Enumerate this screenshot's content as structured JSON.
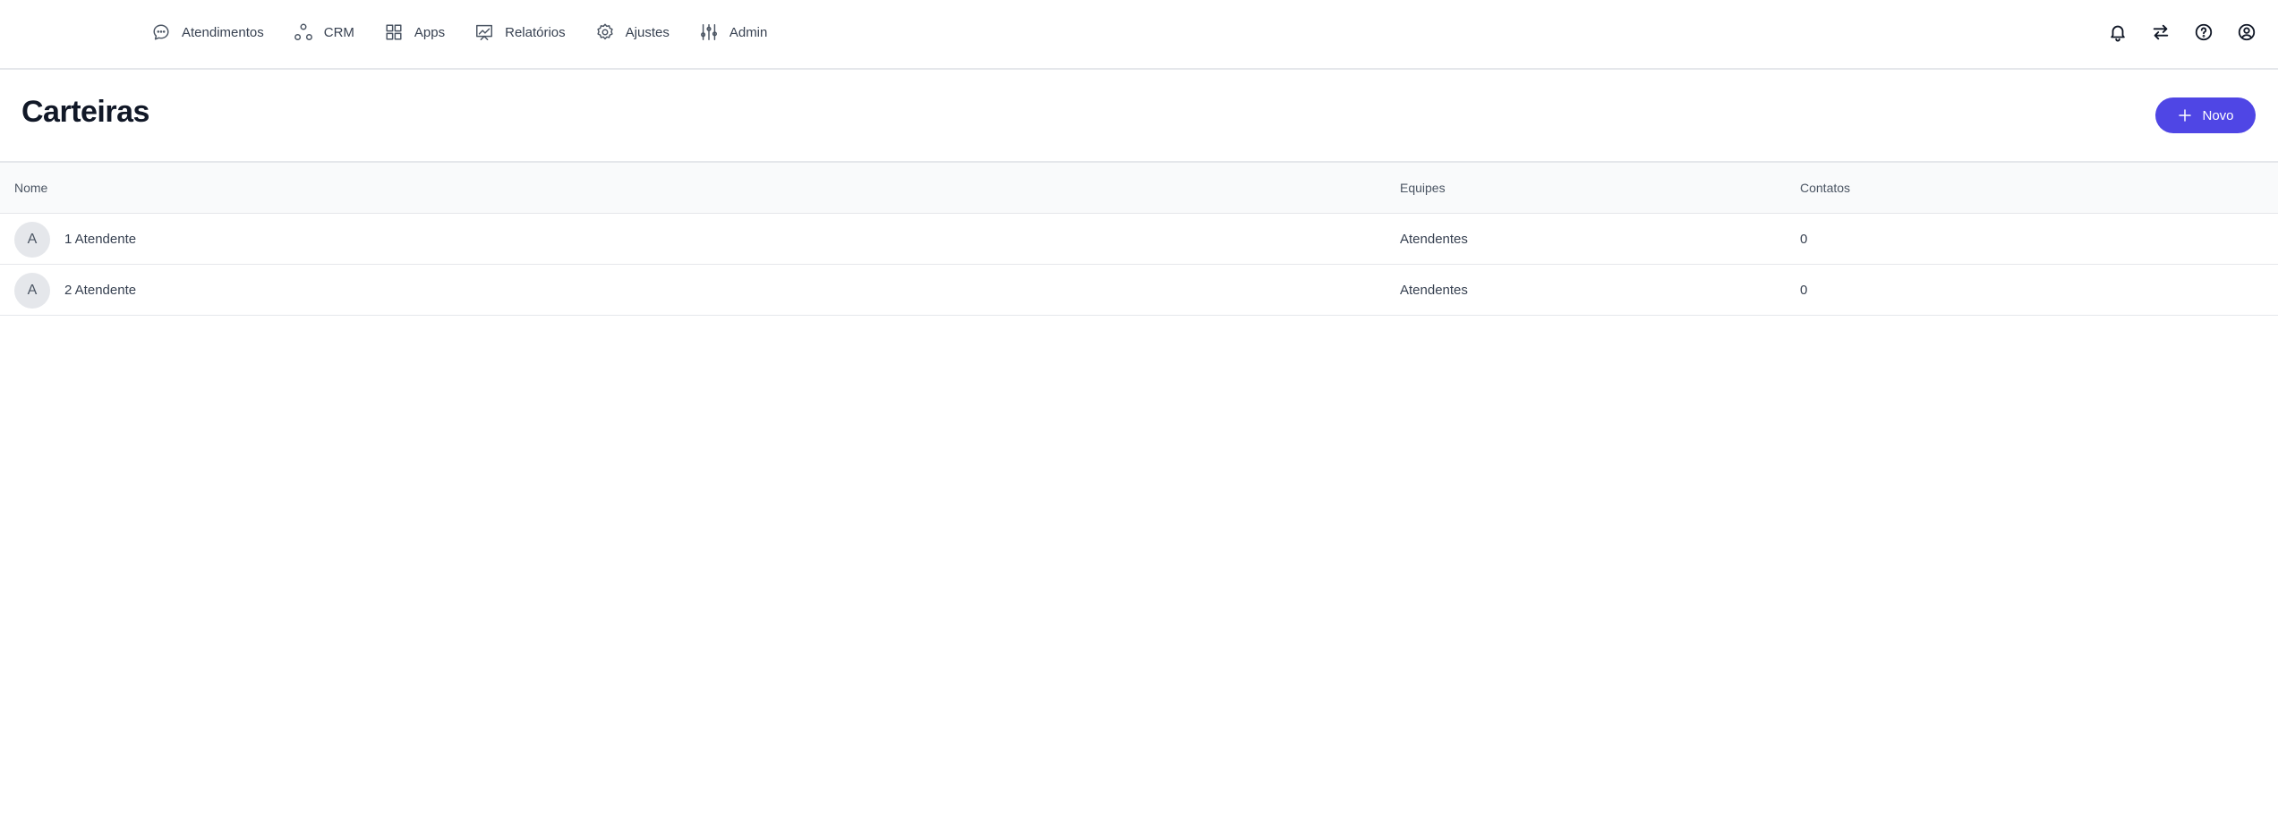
{
  "nav": {
    "items": [
      {
        "label": "Atendimentos",
        "icon": "chat-bubble-icon"
      },
      {
        "label": "CRM",
        "icon": "crm-nodes-icon"
      },
      {
        "label": "Apps",
        "icon": "apps-grid-icon"
      },
      {
        "label": "Relatórios",
        "icon": "reports-chart-icon"
      },
      {
        "label": "Ajustes",
        "icon": "gear-icon"
      },
      {
        "label": "Admin",
        "icon": "sliders-icon"
      }
    ]
  },
  "header_icons": [
    "bell-icon",
    "switch-arrows-icon",
    "help-icon",
    "user-account-icon"
  ],
  "page": {
    "title": "Carteiras",
    "new_button_label": "Novo"
  },
  "table": {
    "columns": {
      "name": "Nome",
      "teams": "Equipes",
      "contacts": "Contatos"
    },
    "rows": [
      {
        "avatar": "A",
        "name": "1 Atendente",
        "teams": "Atendentes",
        "contacts": "0"
      },
      {
        "avatar": "A",
        "name": "2 Atendente",
        "teams": "Atendentes",
        "contacts": "0"
      }
    ]
  },
  "colors": {
    "accent": "#4f46e5",
    "border": "#e5e7eb",
    "header_bg": "#f9fafb"
  }
}
